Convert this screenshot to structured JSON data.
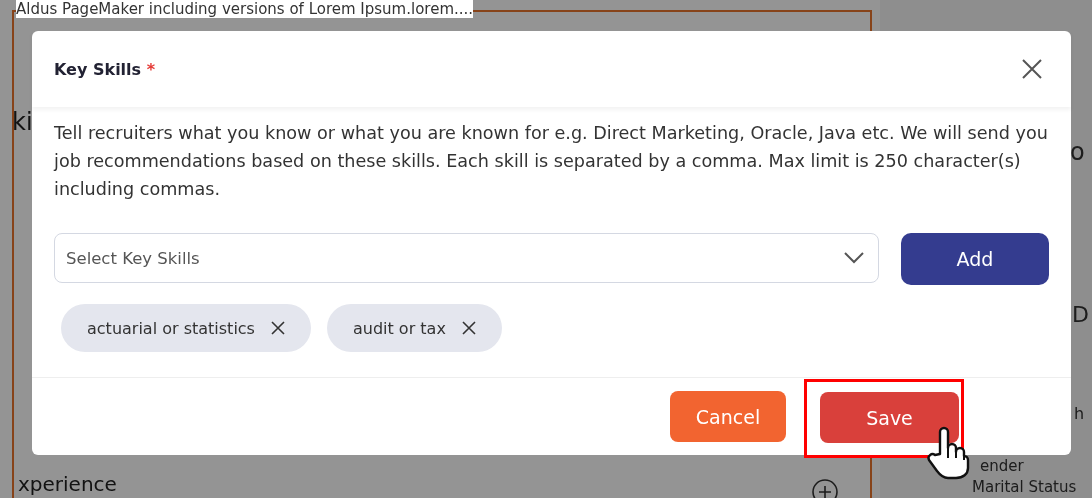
{
  "background": {
    "top_text": "Aldus PageMaker including versions of Lorem Ipsum.lorem....",
    "left_fragments": [
      "ki",
      "xperience"
    ],
    "right_fragments": [
      "o",
      "D",
      "h",
      "ender",
      "Marital Status"
    ]
  },
  "dialog": {
    "title": "Key Skills",
    "required_mark": "*",
    "description": "Tell recruiters what you know or what you are known for e.g. Direct Marketing, Oracle, Java etc. We will send you job recommendations based on these skills. Each skill is separated by a comma. Max limit is 250 character(s) including commas.",
    "select": {
      "placeholder": "Select Key Skills"
    },
    "add_button": "Add",
    "chips": [
      {
        "label": "actuarial or statistics"
      },
      {
        "label": "audit or tax"
      }
    ],
    "buttons": [
      {
        "label": "Cancel",
        "kind": "cancel",
        "highlighted": false
      },
      {
        "label": "Save",
        "kind": "save",
        "highlighted": true
      }
    ]
  }
}
